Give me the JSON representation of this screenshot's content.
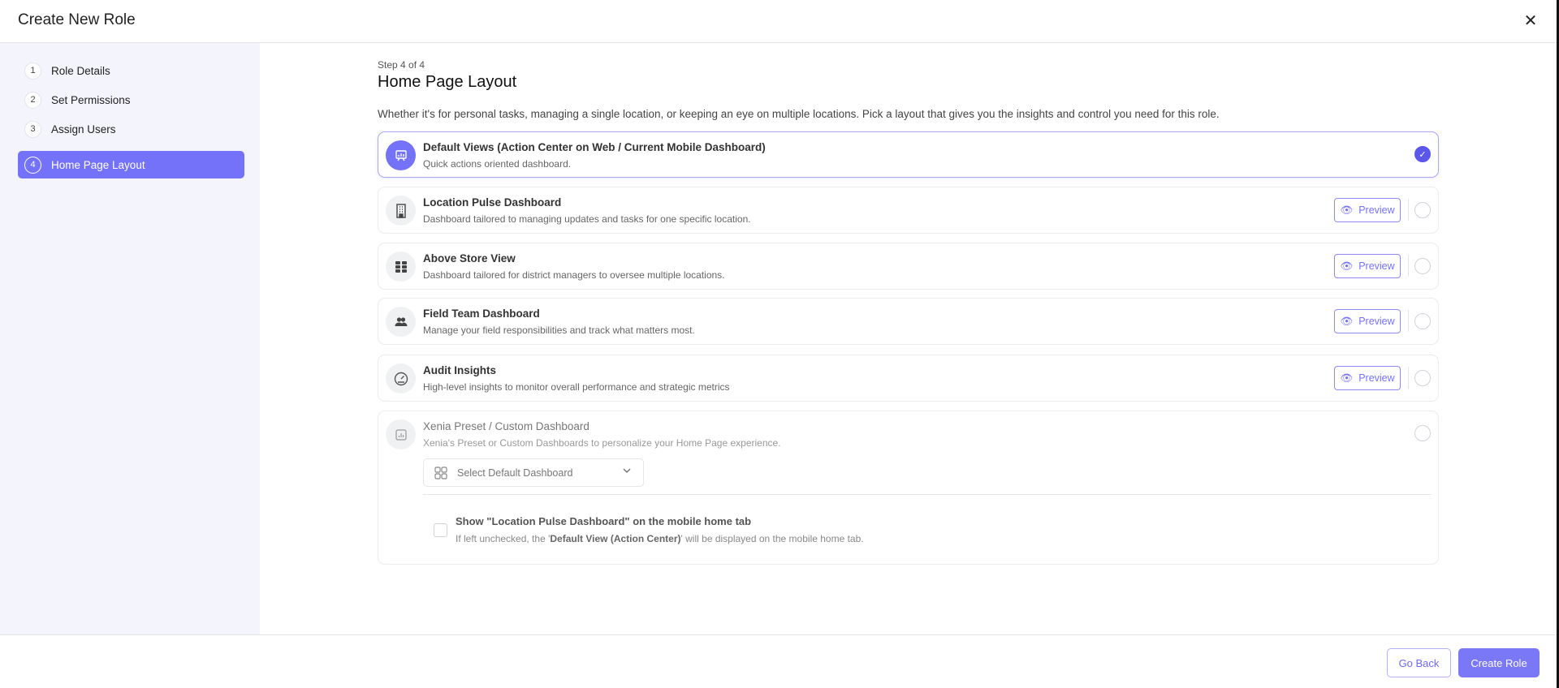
{
  "header": {
    "title": "Create New Role",
    "close_icon": "close-icon"
  },
  "sidebar": {
    "steps": [
      {
        "num": "1",
        "label": "Role Details"
      },
      {
        "num": "2",
        "label": "Set Permissions"
      },
      {
        "num": "3",
        "label": "Assign Users"
      },
      {
        "num": "4",
        "label": "Home Page Layout",
        "active": true
      }
    ]
  },
  "main": {
    "step_label": "Step 4 of 4",
    "heading": "Home Page Layout",
    "description": "Whether it's for personal tasks, managing a single location, or keeping an eye on multiple locations. Pick a layout that gives you the insights and control you need for this role.",
    "options": [
      {
        "title": "Default Views (Action Center on Web / Current Mobile Dashboard)",
        "desc": "Quick actions oriented dashboard.",
        "icon": "presentation-chart-icon",
        "selected": true
      },
      {
        "title": "Location Pulse Dashboard",
        "desc": "Dashboard tailored to managing updates and tasks for one specific location.",
        "icon": "building-icon",
        "preview": "Preview"
      },
      {
        "title": "Above Store View",
        "desc": "Dashboard tailored for district managers to oversee multiple locations.",
        "icon": "grid-icon",
        "preview": "Preview"
      },
      {
        "title": "Field Team Dashboard",
        "desc": "Manage your field responsibilities and track what matters most.",
        "icon": "users-icon",
        "preview": "Preview"
      },
      {
        "title": "Audit Insights",
        "desc": "High-level insights to monitor overall performance and strategic metrics",
        "icon": "gauge-icon",
        "preview": "Preview"
      },
      {
        "title": "Xenia Preset / Custom Dashboard",
        "desc": "Xenia's Preset or Custom Dashboards to personalize your Home Page experience.",
        "icon": "bar-chart-icon",
        "dropdown_placeholder": "Select Default Dashboard",
        "checkbox_title": "Show \"Location Pulse Dashboard\" on the mobile home tab",
        "checkbox_desc_pre": "If left unchecked, the '",
        "checkbox_desc_bold": "Default View (Action Center)",
        "checkbox_desc_post": "' will be displayed on the mobile home tab."
      }
    ]
  },
  "footer": {
    "back_label": "Go Back",
    "create_label": "Create Role"
  },
  "colors": {
    "accent": "#7472f8",
    "selected": "#5b57e8"
  }
}
